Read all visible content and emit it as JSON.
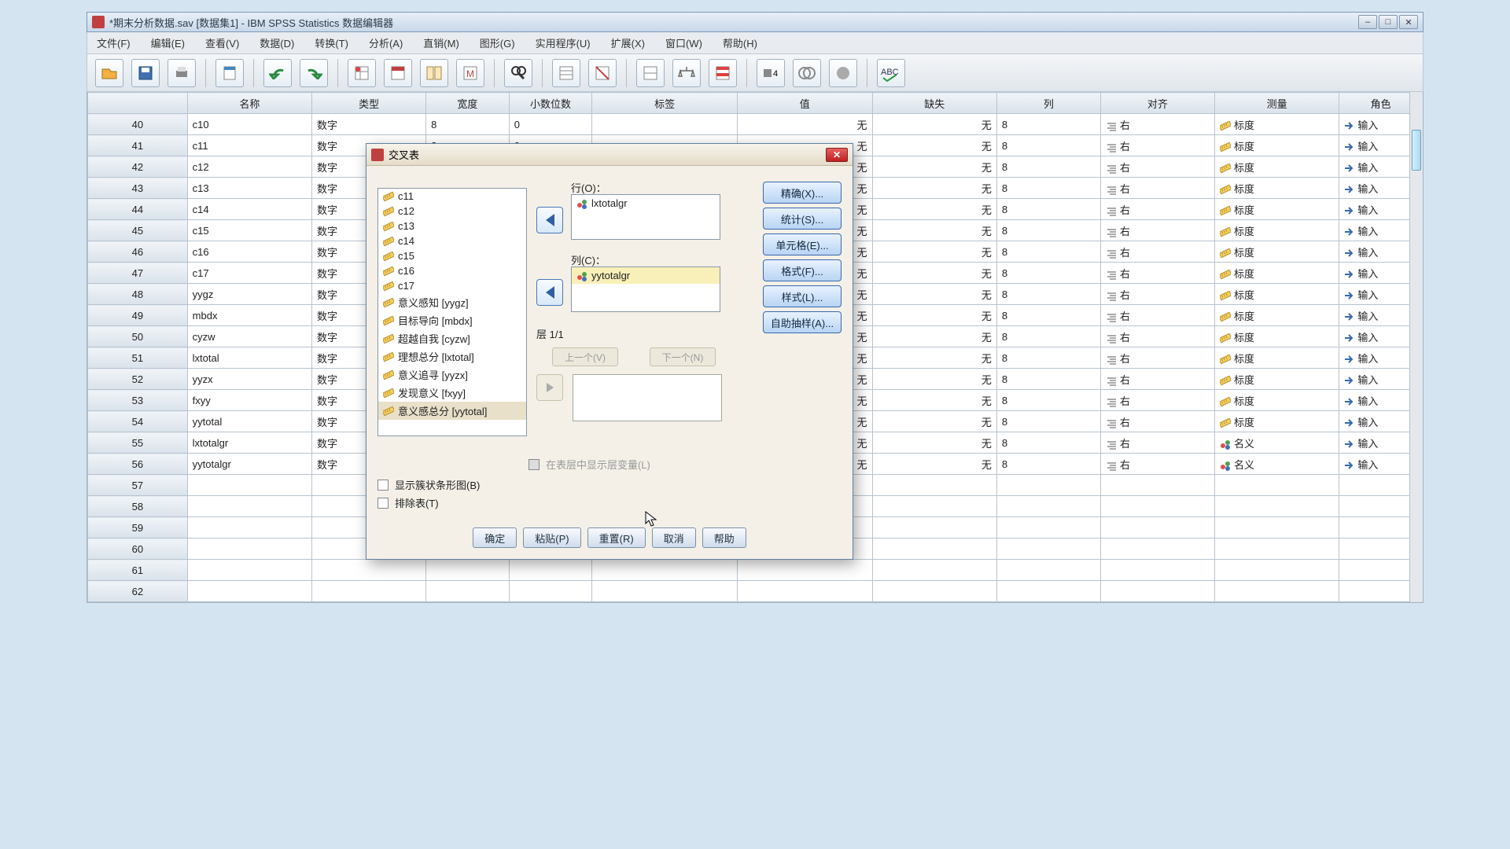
{
  "window": {
    "title": "*期末分析数据.sav [数据集1] - IBM SPSS Statistics 数据编辑器"
  },
  "menu": {
    "file": "文件(F)",
    "edit": "编辑(E)",
    "view": "查看(V)",
    "data": "数据(D)",
    "transform": "转换(T)",
    "analyze": "分析(A)",
    "direct": "直销(M)",
    "graphs": "图形(G)",
    "utilities": "实用程序(U)",
    "extensions": "扩展(X)",
    "window": "窗口(W)",
    "help": "帮助(H)"
  },
  "columns": {
    "name": "名称",
    "type": "类型",
    "width": "宽度",
    "decimals": "小数位数",
    "label": "标签",
    "values": "值",
    "missing": "缺失",
    "columns_col": "列",
    "align": "对齐",
    "measure": "测量",
    "role": "角色"
  },
  "cell_values": {
    "type_numeric": "数字",
    "none": "无",
    "align_right": "右",
    "scale": "标度",
    "nominal": "名义",
    "role_input": "输入",
    "width8": "8",
    "dec0": "0",
    "col8": "8"
  },
  "rows": [
    {
      "num": "40",
      "name": "c10"
    },
    {
      "num": "41",
      "name": "c11"
    },
    {
      "num": "42",
      "name": "c12"
    },
    {
      "num": "43",
      "name": "c13"
    },
    {
      "num": "44",
      "name": "c14"
    },
    {
      "num": "45",
      "name": "c15"
    },
    {
      "num": "46",
      "name": "c16"
    },
    {
      "num": "47",
      "name": "c17"
    },
    {
      "num": "48",
      "name": "yygz"
    },
    {
      "num": "49",
      "name": "mbdx"
    },
    {
      "num": "50",
      "name": "cyzw"
    },
    {
      "num": "51",
      "name": "lxtotal"
    },
    {
      "num": "52",
      "name": "yyzx"
    },
    {
      "num": "53",
      "name": "fxyy"
    },
    {
      "num": "54",
      "name": "yytotal"
    },
    {
      "num": "55",
      "name": "lxtotalgr",
      "nominal": true
    },
    {
      "num": "56",
      "name": "yytotalgr",
      "nominal": true
    },
    {
      "num": "57",
      "name": ""
    },
    {
      "num": "58",
      "name": ""
    },
    {
      "num": "59",
      "name": ""
    },
    {
      "num": "60",
      "name": ""
    },
    {
      "num": "61",
      "name": ""
    },
    {
      "num": "62",
      "name": ""
    }
  ],
  "dialog": {
    "title": "交叉表",
    "row_label": "行(O)：",
    "col_label": "列(C)：",
    "row_var": "lxtotalgr",
    "col_var": "yytotalgr",
    "layer_label": "层 1/1",
    "prev_btn": "上一个(V)",
    "next_btn": "下一个(N)",
    "show_layer_disabled": "在表层中显示层变量(L)",
    "bar_chart_chk": "显示簇状条形图(B)",
    "suppress_chk": "排除表(T)",
    "var_list": [
      "c11",
      "c12",
      "c13",
      "c14",
      "c15",
      "c16",
      "c17",
      "意义感知 [yygz]",
      "目标导向 [mbdx]",
      "超越自我 [cyzw]",
      "理想总分 [lxtotal]",
      "意义追寻 [yyzx]",
      "发现意义 [fxyy]",
      "意义感总分 [yytotal]"
    ],
    "opts": {
      "exact": "精确(X)...",
      "stats": "统计(S)...",
      "cells": "单元格(E)...",
      "format": "格式(F)...",
      "style": "样式(L)...",
      "bootstrap": "自助抽样(A)..."
    },
    "btns": {
      "ok": "确定",
      "paste": "粘贴(P)",
      "reset": "重置(R)",
      "cancel": "取消",
      "help": "帮助"
    }
  }
}
